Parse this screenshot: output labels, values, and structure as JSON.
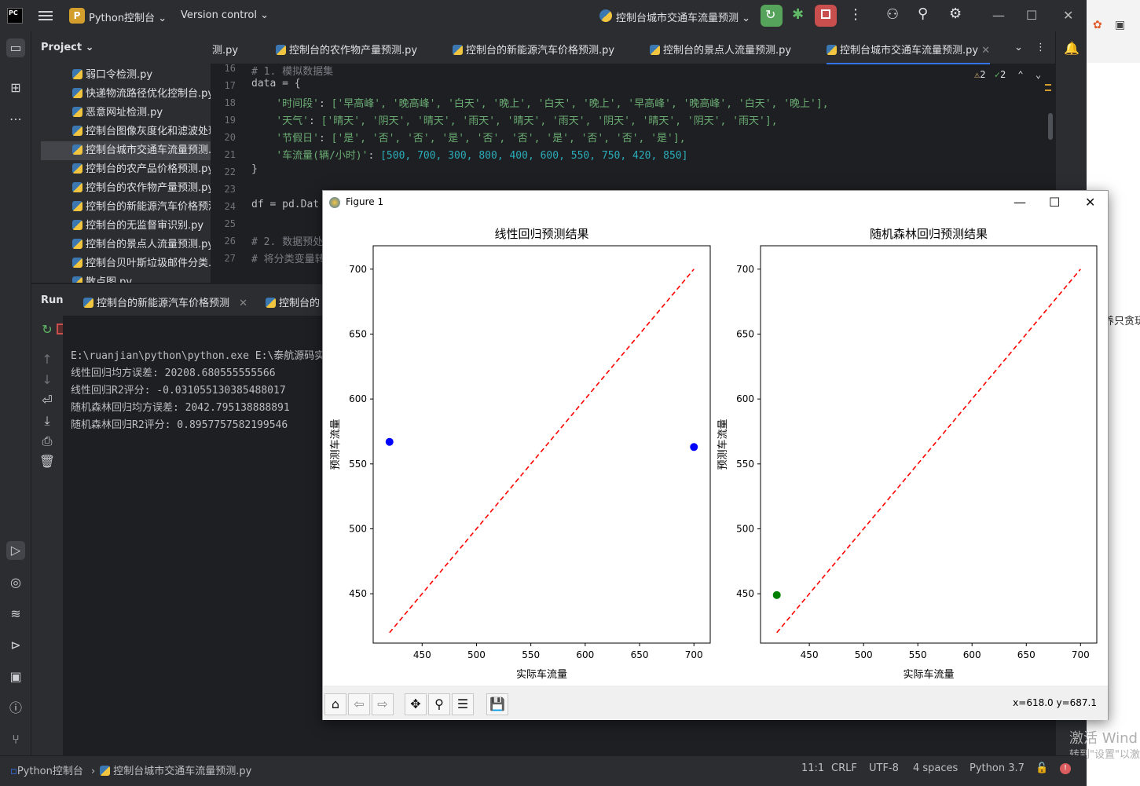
{
  "titlebar": {
    "app_icon_text": "PC",
    "project_badge": "P",
    "project_name": "Python控制台",
    "vcs": "Version control",
    "run_config": "控制台城市交通车流量预测",
    "window_controls": [
      "minimize-icon",
      "maximize-icon",
      "close-icon"
    ]
  },
  "project_panel": {
    "title": "Project",
    "files": [
      "弱口令检测.py",
      "快递物流路径优化控制台.py",
      "恶意网址检测.py",
      "控制台图像灰度化和滤波处理.py",
      "控制台城市交通车流量预测.py",
      "控制台的农产品价格预测.py",
      "控制台的农作物产量预测.py",
      "控制台的新能源汽车价格预测.py",
      "控制台的无监督审识别.py",
      "控制台的景点人流量预测.py",
      "控制台贝叶斯垃圾邮件分类.py",
      "散点图.py"
    ],
    "selected_index": 4
  },
  "editor": {
    "tabs": [
      "测.py",
      "控制台的农作物产量预测.py",
      "控制台的新能源汽车价格预测.py",
      "控制台的景点人流量预测.py",
      "控制台城市交通车流量预测.py"
    ],
    "active_tab": 4,
    "inspections": {
      "warnings": "2",
      "ok": "2"
    },
    "line_numbers": [
      "16",
      "17",
      "18",
      "19",
      "20",
      "21",
      "22",
      "23",
      "24",
      "25",
      "26",
      "27"
    ],
    "lines": {
      "l16": "# 1. 模拟数据集",
      "l17": "data = {",
      "l18_key": "'时间段'",
      "l18_vals": "['早高峰', '晚高峰', '白天', '晚上', '白天', '晚上', '早高峰', '晚高峰', '白天', '晚上'],",
      "l19_key": "'天气'",
      "l19_vals": "['晴天', '阴天', '晴天', '雨天', '晴天', '雨天', '阴天', '晴天', '阴天', '雨天'],",
      "l20_key": "'节假日'",
      "l20_vals": "['是', '否', '否', '是', '否', '否', '是', '否', '否', '是'],",
      "l21_key": "'车流量(辆/小时)'",
      "l21_vals": "[500, 700, 300, 800, 400, 600, 550, 750, 420, 850]",
      "l22": "}",
      "l24": "df = pd.Dat",
      "l26": "# 2. 数据预处",
      "l27": "# 将分类变量转"
    }
  },
  "run_panel": {
    "title": "Run",
    "tabs": [
      "控制台的新能源汽车价格预测",
      "控制台的"
    ],
    "output": [
      "E:\\ruanjian\\python\\python.exe E:\\泰航源码实",
      "线性回归均方误差: 20208.680555555566",
      "线性回归R2评分: -0.031055130385488017",
      "随机森林回归均方误差: 2042.795138888891",
      "随机森林回归R2评分: 0.8957757582199546"
    ]
  },
  "statusbar": {
    "project": "Python控制台",
    "file": "控制台城市交通车流量预测.py",
    "position": "11:1",
    "line_sep": "CRLF",
    "encoding": "UTF-8",
    "indent": "4 spaces",
    "interpreter": "Python 3.7"
  },
  "figure_window": {
    "title": "Figure 1",
    "coords": "x=618.0 y=687.1",
    "toolbar_icons": [
      "home-icon",
      "back-icon",
      "forward-icon",
      "pan-icon",
      "zoom-icon",
      "configure-icon",
      "save-icon"
    ]
  },
  "desktop": {
    "avatar_text": "养只贪玩",
    "watermark_line1": "激活 Wind",
    "watermark_line2": "转到\"设置\"以激"
  },
  "chart_data": [
    {
      "type": "scatter",
      "title": "线性回归预测结果",
      "xlabel": "实际车流量",
      "ylabel": "预测车流量",
      "xlim": [
        405,
        715
      ],
      "ylim": [
        412,
        718
      ],
      "xticks": [
        450,
        500,
        550,
        600,
        650,
        700
      ],
      "yticks": [
        450,
        500,
        550,
        600,
        650,
        700
      ],
      "points": [
        {
          "x": 420,
          "y": 567
        },
        {
          "x": 700,
          "y": 563
        }
      ],
      "point_color": "#0000ff",
      "reference_line": {
        "from": [
          420,
          420
        ],
        "to": [
          700,
          700
        ],
        "color": "#ff0000",
        "style": "dashed"
      }
    },
    {
      "type": "scatter",
      "title": "随机森林回归预测结果",
      "xlabel": "实际车流量",
      "ylabel": "预测车流量",
      "xlim": [
        405,
        715
      ],
      "ylim": [
        412,
        718
      ],
      "xticks": [
        450,
        500,
        550,
        600,
        650,
        700
      ],
      "yticks": [
        450,
        500,
        550,
        600,
        650,
        700
      ],
      "points": [
        {
          "x": 420,
          "y": 449
        }
      ],
      "point_color": "#008000",
      "reference_line": {
        "from": [
          420,
          420
        ],
        "to": [
          700,
          700
        ],
        "color": "#ff0000",
        "style": "dashed"
      }
    }
  ]
}
